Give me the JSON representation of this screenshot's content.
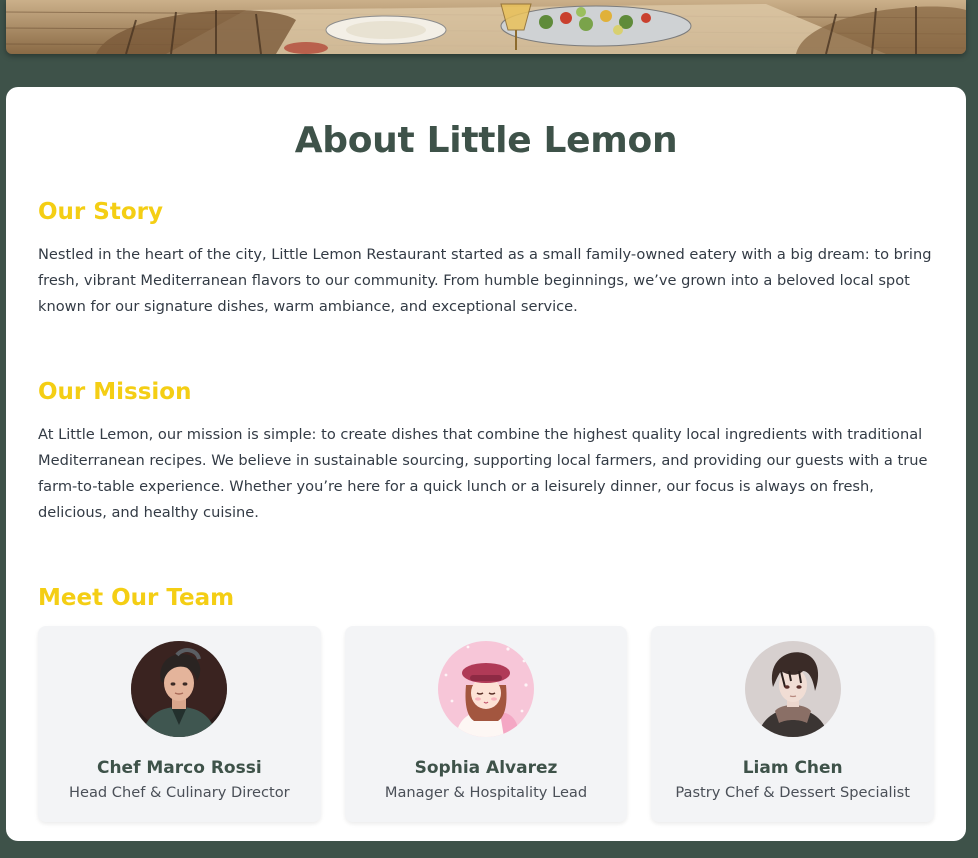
{
  "about": {
    "title": "About Little Lemon",
    "story": {
      "heading": "Our Story",
      "text": "Nestled in the heart of the city, Little Lemon Restaurant started as a small family-owned eatery with a big dream: to bring fresh, vibrant Mediterranean flavors to our community. From humble beginnings, we’ve grown into a beloved local spot known for our signature dishes, warm ambiance, and exceptional service."
    },
    "mission": {
      "heading": "Our Mission",
      "text": "At Little Lemon, our mission is simple: to create dishes that combine the highest quality local ingredients with traditional Mediterranean recipes. We believe in sustainable sourcing, supporting local farmers, and providing our guests with a true farm-to-table experience. Whether you’re here for a quick lunch or a leisurely dinner, our focus is always on fresh, delicious, and healthy cuisine."
    },
    "team": {
      "heading": "Meet Our Team",
      "members": [
        {
          "name": "Chef Marco Rossi",
          "role": "Head Chef & Culinary Director"
        },
        {
          "name": "Sophia Alvarez",
          "role": "Manager & Hospitality Lead"
        },
        {
          "name": "Liam Chen",
          "role": "Pastry Chef & Dessert Specialist"
        }
      ]
    }
  },
  "colors": {
    "background": "#3e5249",
    "title": "#3e5249",
    "accent_yellow": "#f4ce14",
    "body_text": "#333b45",
    "card_bg": "#f3f4f6"
  }
}
